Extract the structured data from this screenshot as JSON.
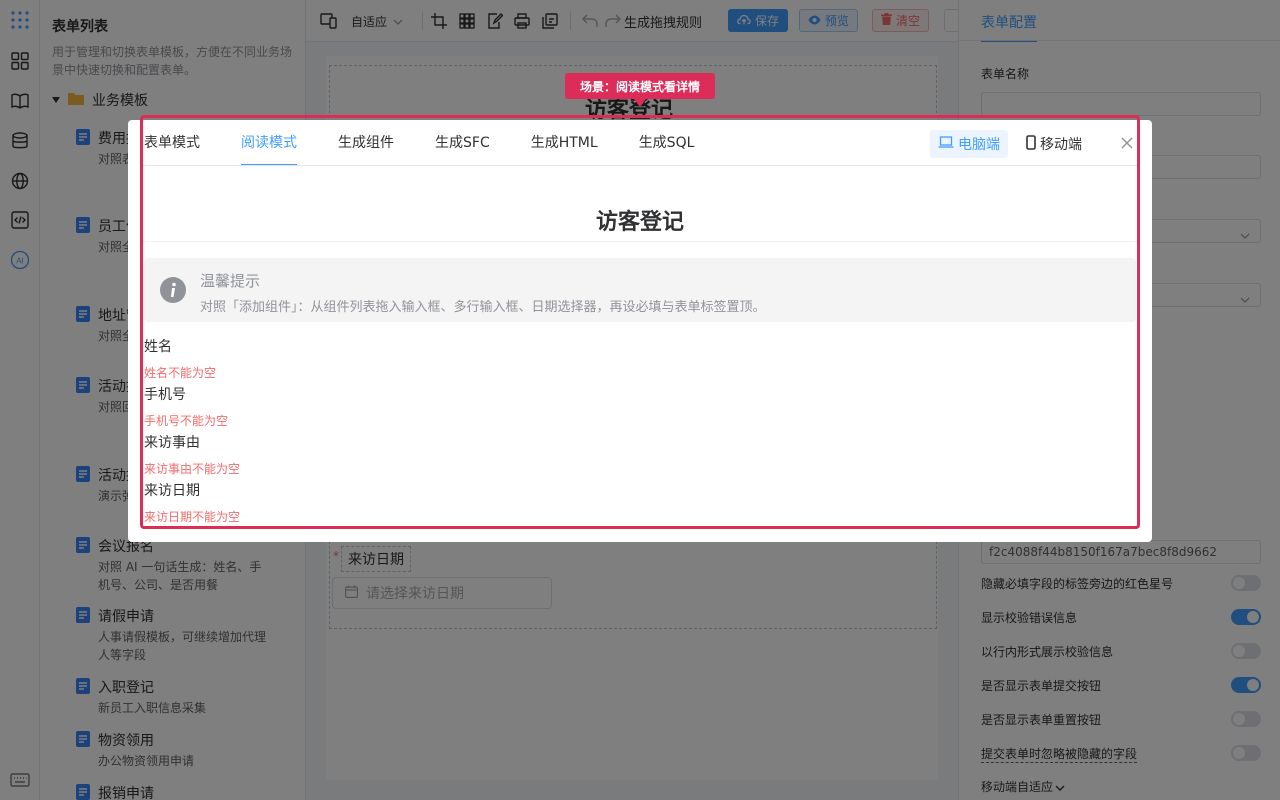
{
  "templates_panel": {
    "title": "表单列表",
    "description": "用于管理和切换表单模板，方便在不同业务场景中快速切换和配置表单。",
    "group_label": "业务模板",
    "items": [
      {
        "name": "费用报销",
        "desc": "对照表明/快式+必"
      },
      {
        "name": "员工信息",
        "desc": "对照全局变量"
      },
      {
        "name": "地址管理",
        "desc": "对照全按钮 /"
      },
      {
        "name": "活动报名",
        "desc": "对照回 + 数据 api.t"
      },
      {
        "name": "活动报名",
        "desc": "演示弹选品回"
      },
      {
        "name": "会议报名",
        "desc": "对照 AI 一句话生成：姓名、手机号、公司、是否用餐"
      },
      {
        "name": "请假申请",
        "desc": "人事请假模板，可继续增加代理人等字段"
      },
      {
        "name": "入职登记",
        "desc": "新员工入职信息采集"
      },
      {
        "name": "物资领用",
        "desc": "办公物资领用申请"
      },
      {
        "name": "报销申请",
        "desc": ""
      }
    ]
  },
  "toolbar": {
    "adapt_label": "自适应",
    "rules_label": "生成拖拽规则",
    "save_label": "保存",
    "preview_label": "预览",
    "clear_label": "清空"
  },
  "canvas": {
    "form_title": "访客登记",
    "date_label": "来访日期",
    "date_placeholder": "请选择来访日期"
  },
  "config_panel": {
    "tab_label": "表单配置",
    "form_name_label": "表单名称",
    "form_name_value": "",
    "form_id_value": "f2c4088f44b8150f167a7bec8f8d9662",
    "switches": [
      {
        "label": "隐藏必填字段的标签旁边的红色星号",
        "on": false
      },
      {
        "label": "显示校验错误信息",
        "on": true
      },
      {
        "label": "以行内形式展示校验信息",
        "on": false
      },
      {
        "label": "是否显示表单提交按钮",
        "on": true
      },
      {
        "label": "是否显示表单重置按钮",
        "on": false
      },
      {
        "label": "提交表单时忽略被隐藏的字段",
        "on": false
      }
    ],
    "mobile_adapt_label": "移动端自适应"
  },
  "dialog": {
    "tabs": [
      "表单模式",
      "阅读模式",
      "生成组件",
      "生成SFC",
      "生成HTML",
      "生成SQL"
    ],
    "active_tab": "阅读模式",
    "device_pc_label": "电脑端",
    "device_mobile_label": "移动端",
    "form_title": "访客登记",
    "tip_title": "温馨提示",
    "tip_text": "对照「添加组件」：从组件列表拖入输入框、多行输入框、日期选择器，再设必填与表单标签置顶。",
    "fields": [
      {
        "label": "姓名",
        "error": "姓名不能为空"
      },
      {
        "label": "手机号",
        "error": "手机号不能为空"
      },
      {
        "label": "来访事由",
        "error": "来访事由不能为空"
      },
      {
        "label": "来访日期",
        "error": "来访日期不能为空"
      }
    ]
  },
  "scenario_badge": "场景：阅读模式看详情",
  "colors": {
    "primary": "#409eff",
    "highlight": "#dc2c58",
    "danger": "#f56c6c"
  }
}
